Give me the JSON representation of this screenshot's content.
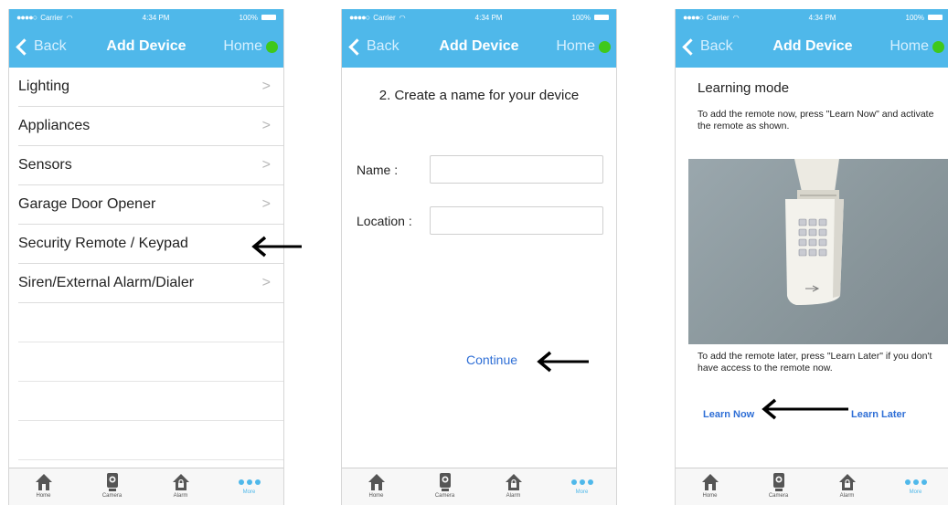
{
  "status": {
    "carrier": "Carrier",
    "time": "4:34 PM",
    "battery": "100%"
  },
  "nav": {
    "back": "Back",
    "title": "Add Device",
    "home": "Home"
  },
  "screen1": {
    "items": [
      {
        "label": "Lighting",
        "chevron": ">"
      },
      {
        "label": "Appliances",
        "chevron": ">"
      },
      {
        "label": "Sensors",
        "chevron": ">"
      },
      {
        "label": "Garage Door Opener",
        "chevron": ">"
      },
      {
        "label": "Security Remote / Keypad",
        "chevron": ""
      },
      {
        "label": "Siren/External Alarm/Dialer",
        "chevron": ">"
      }
    ]
  },
  "screen2": {
    "step_title": "2. Create a name for your device",
    "name_label": "Name :",
    "name_value": "",
    "location_label": "Location :",
    "location_value": "",
    "continue": "Continue"
  },
  "screen3": {
    "title": "Learning mode",
    "instruction_now": "To add the remote now, press \"Learn Now\" and activate the remote as shown.",
    "instruction_later": "To add the remote later, press \"Learn Later\" if you don't have access to the remote now.",
    "learn_now": "Learn Now",
    "learn_later": "Learn Later"
  },
  "tabs": [
    {
      "label": "Home",
      "icon": "home-icon"
    },
    {
      "label": "Camera",
      "icon": "camera-icon"
    },
    {
      "label": "Alarm",
      "icon": "alarm-icon"
    },
    {
      "label": "More",
      "icon": "more-icon"
    }
  ],
  "colors": {
    "header": "#4fb8ea",
    "link": "#2f6fd6",
    "status_online": "#3fc81c"
  }
}
